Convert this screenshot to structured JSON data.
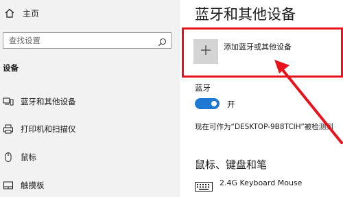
{
  "sidebar": {
    "home_label": "主页",
    "search_placeholder": "查找设置",
    "section_title": "设备",
    "items": [
      {
        "label": "蓝牙和其他设备",
        "icon": "bluetooth-devices-icon"
      },
      {
        "label": "打印机和扫描仪",
        "icon": "printer-icon"
      },
      {
        "label": "鼠标",
        "icon": "mouse-icon"
      },
      {
        "label": "触摸板",
        "icon": "touchpad-icon"
      }
    ]
  },
  "main": {
    "title": "蓝牙和其他设备",
    "add_device_label": "添加蓝牙或其他设备",
    "bluetooth_label": "蓝牙",
    "bluetooth_state": "开",
    "discoverable_text": "现在可作为“DESKTOP-9B8TCIH”被检测到",
    "section_mouse_keyboard": "鼠标、键盘和笔",
    "devices": [
      {
        "name": "2.4G Keyboard Mouse",
        "icon": "keyboard-icon"
      }
    ]
  },
  "colors": {
    "accent": "#1f78d1",
    "highlight": "#e8121d",
    "sidebar_bg": "#f2f2f2"
  }
}
